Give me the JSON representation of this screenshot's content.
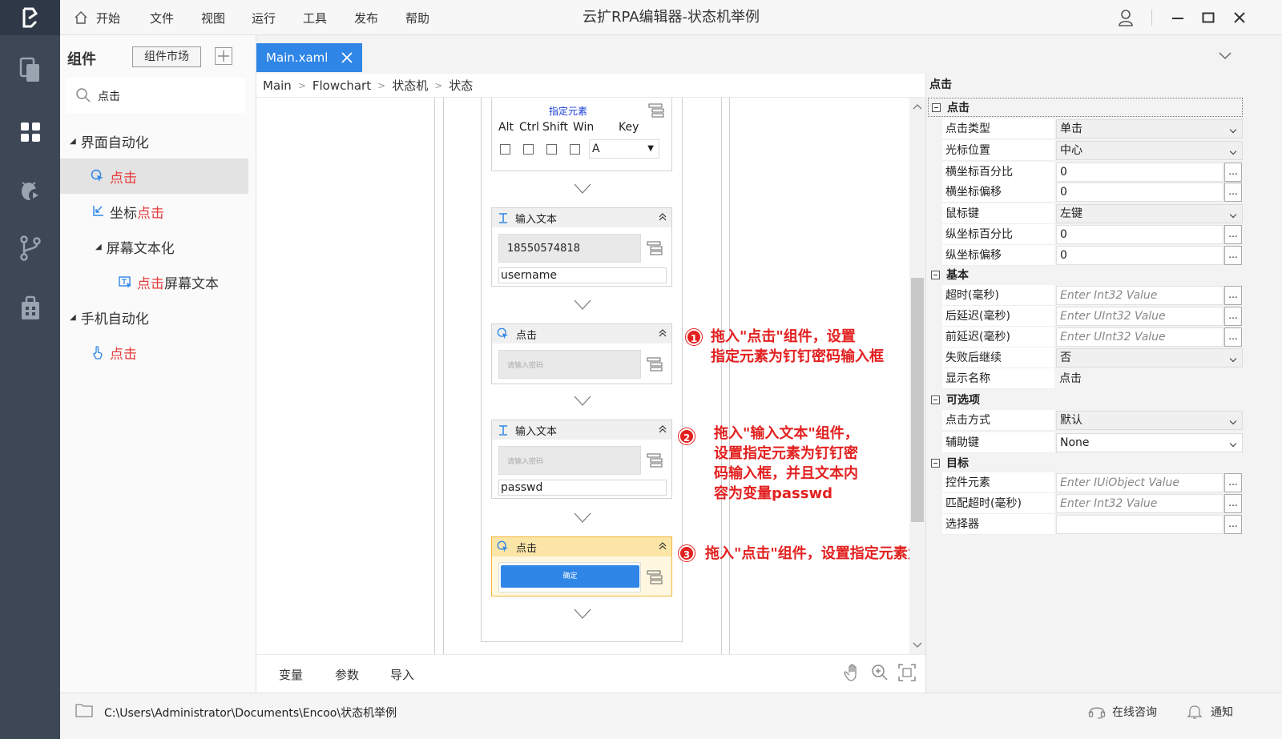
{
  "app": {
    "title": "云扩RPA编辑器-状态机举例",
    "menu": [
      "开始",
      "文件",
      "视图",
      "运行",
      "工具",
      "发布",
      "帮助"
    ]
  },
  "components": {
    "title": "组件",
    "market_label": "组件市场",
    "search_value": "点击",
    "tree": [
      {
        "prefix": "",
        "highlight": "",
        "label": "界面自动化"
      },
      {
        "prefix": "",
        "highlight": "点击",
        "label": ""
      },
      {
        "prefix": "坐标",
        "highlight": "点击",
        "label": ""
      },
      {
        "prefix": "",
        "highlight": "",
        "label": "屏幕文本化"
      },
      {
        "prefix": "",
        "highlight": "点击",
        "label": "屏幕文本"
      },
      {
        "prefix": "",
        "highlight": "",
        "label": "手机自动化"
      },
      {
        "prefix": "",
        "highlight": "点击",
        "label": ""
      }
    ]
  },
  "tab": {
    "label": "Main.xaml"
  },
  "breadcrumb": [
    "Main",
    "Flowchart",
    "状态机",
    "状态"
  ],
  "canvas": {
    "hotkey": {
      "element_label": "指定元素",
      "modifiers": [
        "Alt",
        "Ctrl",
        "Shift",
        "Win"
      ],
      "key_label": "Key",
      "key_value": "A"
    },
    "activities": [
      {
        "title": "输入文本",
        "element": "18550574818",
        "text": "username"
      },
      {
        "title": "点击",
        "element": "请输入密码"
      },
      {
        "title": "输入文本",
        "element": "请输入密码",
        "text": "passwd"
      },
      {
        "title": "点击",
        "element": "确定"
      }
    ],
    "callouts": [
      {
        "num": "1",
        "lines": [
          "拖入\"点击\"组件，设置",
          "指定元素为钉钉密码输入框"
        ]
      },
      {
        "num": "2",
        "lines": [
          "拖入\"输入文本\"组件，",
          "设置指定元素为钉钉密",
          "码输入框，并且文本内",
          "容为变量passwd"
        ]
      },
      {
        "num": "3",
        "lines": [
          "拖入\"点击\"组件，设置指定元素为登录按钮"
        ]
      }
    ],
    "bottom_tabs": [
      "变量",
      "参数",
      "导入"
    ]
  },
  "properties": {
    "title": "点击",
    "sections": {
      "click": "点击",
      "basic": "基本",
      "options": "可选项",
      "target": "目标"
    },
    "rows": {
      "click_type": {
        "label": "点击类型",
        "value": "单击"
      },
      "cursor_pos": {
        "label": "光标位置",
        "value": "中心"
      },
      "x_percent": {
        "label": "横坐标百分比",
        "value": "0"
      },
      "x_offset": {
        "label": "横坐标偏移",
        "value": "0"
      },
      "mouse_btn": {
        "label": "鼠标键",
        "value": "左键"
      },
      "y_percent": {
        "label": "纵坐标百分比",
        "value": "0"
      },
      "y_offset": {
        "label": "纵坐标偏移",
        "value": "0"
      },
      "timeout": {
        "label": "超时(毫秒)",
        "value": "Enter Int32 Value"
      },
      "after_delay": {
        "label": "后延迟(毫秒)",
        "value": "Enter UInt32 Value"
      },
      "before_delay": {
        "label": "前延迟(毫秒)",
        "value": "Enter UInt32 Value"
      },
      "continue_on_error": {
        "label": "失败后继续",
        "value": "否"
      },
      "display_name": {
        "label": "显示名称",
        "value": "点击"
      },
      "click_mode": {
        "label": "点击方式",
        "value": "默认"
      },
      "modifier_key": {
        "label": "辅助键",
        "value": "None"
      },
      "control_element": {
        "label": "控件元素",
        "value": "Enter IUiObject Value"
      },
      "match_timeout": {
        "label": "匹配超时(毫秒)",
        "value": "Enter Int32 Value"
      },
      "selector": {
        "label": "选择器",
        "value": ""
      }
    }
  },
  "status": {
    "path": "C:\\Users\\Administrator\\Documents\\Encoo\\状态机举例",
    "consult": "在线咨询",
    "notify": "通知"
  },
  "colors": {
    "accent": "#2f86e6",
    "rail": "#3d4756",
    "highlight_red": "#e6393a",
    "callout_red": "#e32020"
  }
}
